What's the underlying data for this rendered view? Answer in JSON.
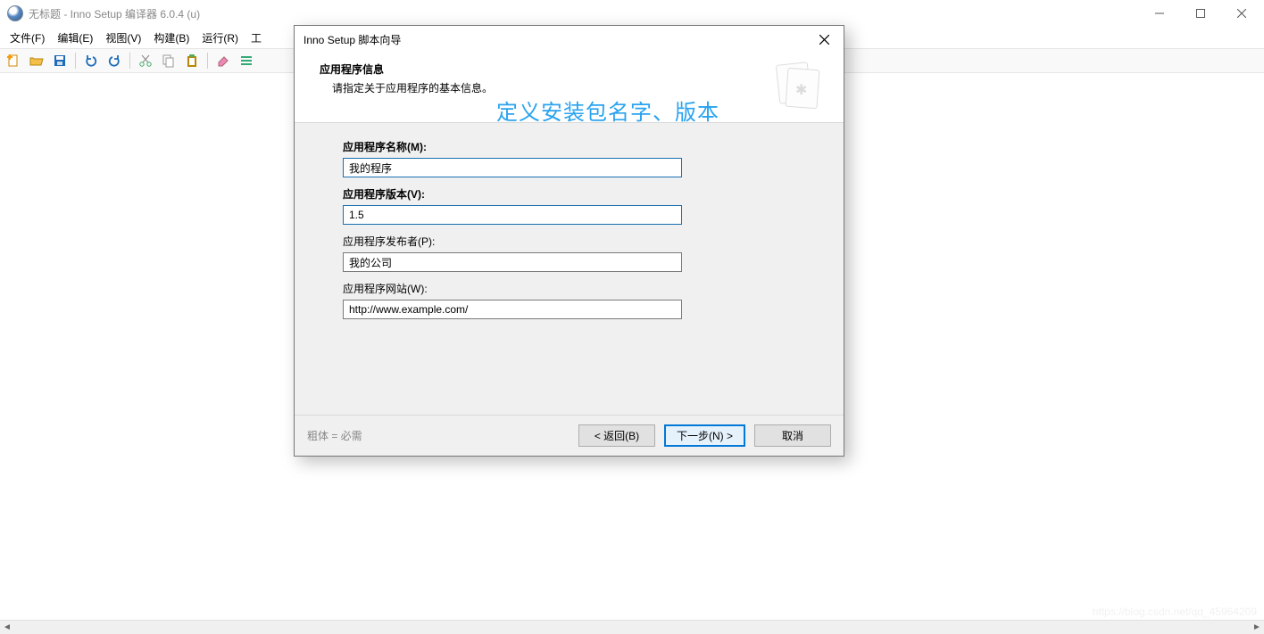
{
  "window": {
    "title": "无标题 - Inno Setup 编译器 6.0.4 (u)"
  },
  "menu": {
    "file": "文件(F)",
    "edit": "编辑(E)",
    "view": "视图(V)",
    "build": "构建(B)",
    "run": "运行(R)",
    "tools": "工"
  },
  "dialog": {
    "title": "Inno Setup 脚本向导",
    "header": {
      "heading": "应用程序信息",
      "sub": "请指定关于应用程序的基本信息。"
    },
    "annotation": "定义安装包名字、版本",
    "fields": {
      "name_label": "应用程序名称(M):",
      "name_value": "我的程序",
      "version_label": "应用程序版本(V):",
      "version_value": "1.5",
      "publisher_label": "应用程序发布者(P):",
      "publisher_value": "我的公司",
      "website_label": "应用程序网站(W):",
      "website_value": "http://www.example.com/"
    },
    "footer": {
      "note": "粗体 = 必需",
      "back": "< 返回(B)",
      "next": "下一步(N) >",
      "cancel": "取消"
    }
  },
  "watermark": "https://blog.csdn.net/qq_45964209"
}
